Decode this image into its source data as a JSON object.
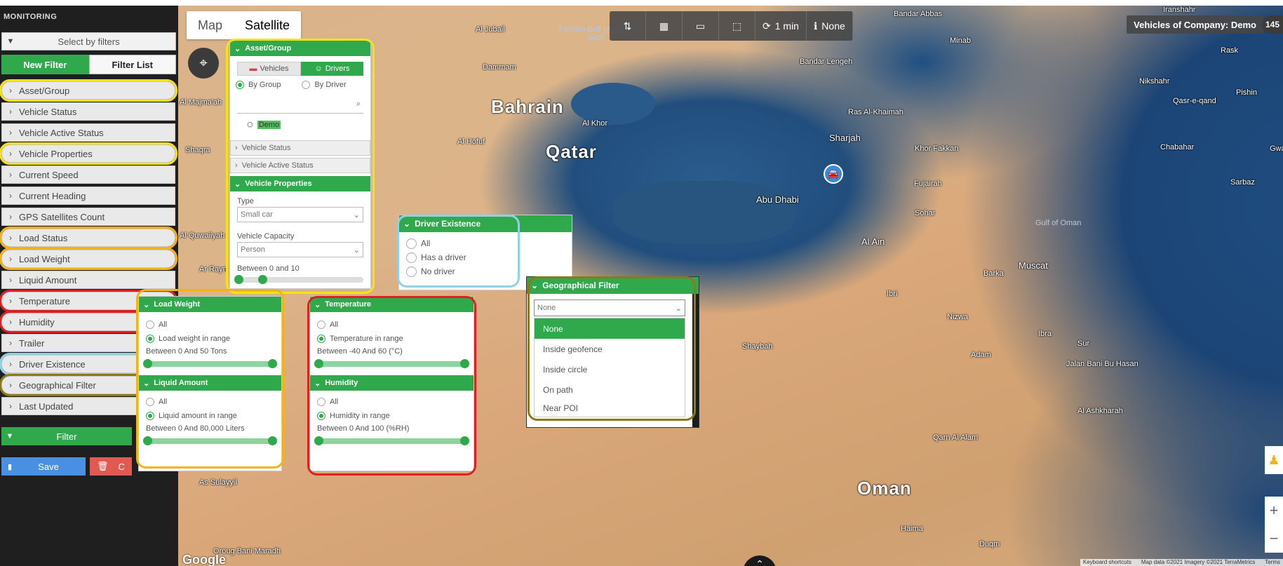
{
  "sidebar": {
    "title": "MONITORING",
    "search_placeholder": "Select by filters",
    "tabs": [
      {
        "label": "New Filter"
      },
      {
        "label": "Filter List"
      }
    ],
    "items": [
      {
        "label": "Asset/Group"
      },
      {
        "label": "Vehicle Status"
      },
      {
        "label": "Vehicle Active Status"
      },
      {
        "label": "Vehicle Properties"
      },
      {
        "label": "Current Speed"
      },
      {
        "label": "Current Heading"
      },
      {
        "label": "GPS Satellites Count"
      },
      {
        "label": "Load Status"
      },
      {
        "label": "Load Weight"
      },
      {
        "label": "Liquid Amount"
      },
      {
        "label": "Temperature"
      },
      {
        "label": "Humidity"
      },
      {
        "label": "Trailer"
      },
      {
        "label": "Driver Existence"
      },
      {
        "label": "Geographical Filter"
      },
      {
        "label": "Last Updated"
      }
    ],
    "filter_label": "Filter",
    "save_label": "Save",
    "delete_label": "C"
  },
  "map": {
    "type_tabs": [
      {
        "label": "Map"
      },
      {
        "label": "Satellite"
      }
    ],
    "toolbar": {
      "refresh_label": "1 min",
      "info_label": "None"
    },
    "company_label": "Vehicles of Company: Demo",
    "vehicle_count": "145",
    "google": "Google",
    "attribution": [
      "Keyboard shortcuts",
      "Map data ©2021 Imagery ©2021 TerraMetrics",
      "Terms"
    ],
    "places": {
      "bahrain": "Bahrain",
      "qatar": "Qatar",
      "oman": "Oman",
      "abu_dhabi": "Abu Dhabi",
      "sharjah": "Sharjah",
      "muscat": "Muscat",
      "al_jubail": "Al Jubail",
      "dammam": "Dammam",
      "al_khor": "Al Khor",
      "al_hofuf": "Al Hofuf",
      "ras_al_khaimah": "Ras Al-Khaimah",
      "fujairah": "Fujairah",
      "sohar": "Sohar",
      "al_ain": "Al Ain",
      "minab": "Minab",
      "bandar_abbas": "Bandar Abbas",
      "bandar_lengeh": "Bandar Lengeh",
      "khor_fakkan": "Khor Fakkan",
      "ibri": "Ibri",
      "nizwa": "Nizwa",
      "barka": "Barka",
      "sur": "Sur",
      "ibra": "Ibra",
      "adam": "Adam",
      "jalan_bani_bu_hasan": "Jalan Bani Bu Hasan",
      "al_ashkharah": "Al Ashkharah",
      "qarn_al_alam": "Qarn Al Alam",
      "haima": "Haima",
      "duqm": "Duqm",
      "shaybah": "Shaybah",
      "gulf_of_oman": "Gulf of Oman",
      "persian_gulf": "Persian Gulf (Arabian Gulf)",
      "al_majmaah": "Al Majma'ah",
      "shaqra": "Shaqra",
      "al_quwaiyah": "Al Quwaiiyah",
      "ar_rayn": "Ar Rayn",
      "as_sulayyil": "As Sulayyil",
      "oroug_bani_maradh": "Oroug Bani Maradh",
      "iranshahr": "Iranshahr",
      "nikshahr": "Nikshahr",
      "chabahar": "Chabahar",
      "pishin": "Pishin",
      "rask": "Rask",
      "sarbaz": "Sarbaz",
      "qasr_e_qand": "Qasr-e-qand",
      "ghwadar": "Gwadar"
    }
  },
  "panels": {
    "asset_group": {
      "title": "Asset/Group",
      "tabs": [
        {
          "label": "Vehicles"
        },
        {
          "label": "Drivers"
        }
      ],
      "radios": [
        {
          "label": "By Group",
          "checked": true
        },
        {
          "label": "By Driver",
          "checked": false
        }
      ],
      "group_tag": "Demo",
      "collapsed": [
        {
          "label": "Vehicle Status"
        },
        {
          "label": "Vehicle Active Status"
        }
      ],
      "vehicle_properties_title": "Vehicle Properties",
      "type_label": "Type",
      "type_value": "Small car",
      "capacity_label": "Vehicle Capacity",
      "capacity_value": "Person",
      "range_text": "Between 0 and 10"
    },
    "load_weight": {
      "title": "Load Weight",
      "radios": [
        {
          "label": "All",
          "checked": false
        },
        {
          "label": "Load weight in range",
          "checked": true
        }
      ],
      "range_text": "Between 0 And 50 Tons"
    },
    "liquid_amount": {
      "title": "Liquid Amount",
      "radios": [
        {
          "label": "All",
          "checked": false
        },
        {
          "label": "Liquid amount in range",
          "checked": true
        }
      ],
      "range_text": "Between 0 And 80,000 Liters"
    },
    "temperature": {
      "title": "Temperature",
      "radios": [
        {
          "label": "All",
          "checked": false
        },
        {
          "label": "Temperature in range",
          "checked": true
        }
      ],
      "range_text": "Between -40 And 60 (°C)"
    },
    "humidity": {
      "title": "Humidity",
      "radios": [
        {
          "label": "All",
          "checked": false
        },
        {
          "label": "Humidity in range",
          "checked": true
        }
      ],
      "range_text": "Between 0 And 100 (%RH)"
    },
    "driver_existence": {
      "title": "Driver Existence",
      "options": [
        {
          "label": "All"
        },
        {
          "label": "Has a driver"
        },
        {
          "label": "No driver"
        }
      ]
    },
    "geographical": {
      "title": "Geographical Filter",
      "selected": "None",
      "options": [
        {
          "label": "None"
        },
        {
          "label": "Inside geofence"
        },
        {
          "label": "Inside circle"
        },
        {
          "label": "On path"
        },
        {
          "label": "Near POI"
        }
      ]
    }
  },
  "colors": {
    "accent_green": "#2fa94b",
    "highlight_yellow": "#f6e317",
    "highlight_orange": "#f3b315",
    "highlight_red": "#e02020",
    "highlight_blue": "#8fd2e6",
    "highlight_olive": "#8c7a1a"
  }
}
